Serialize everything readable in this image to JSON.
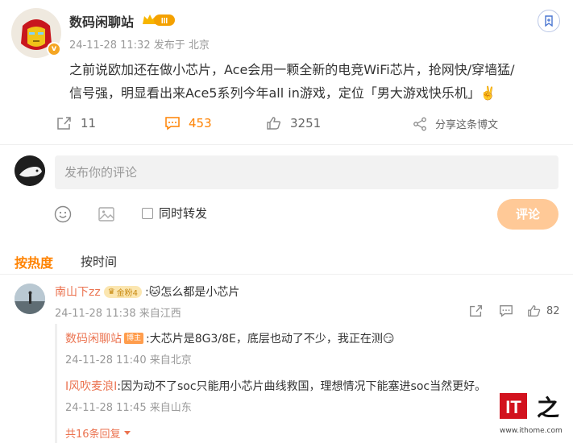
{
  "post": {
    "author": "数码闲聊站",
    "badge_level": "III",
    "verified_mark": "v",
    "meta": "24-11-28 11:32  发布于 北京",
    "content": "之前说欧加还在做小芯片，Ace会用一颗全新的电竞WiFi芯片，抢网快/穿墙猛/信号强，明显看出来Ace5系列今年all in游戏，定位「男大游戏快乐机」✌️",
    "actions": {
      "repost_count": "11",
      "comment_count": "453",
      "like_count": "3251",
      "share_label": "分享这条博文"
    }
  },
  "compose": {
    "placeholder": "发布你的评论",
    "forward_label": "同时转发",
    "submit_label": "评论"
  },
  "sort": {
    "hot_label": "按热度",
    "time_label": "按时间"
  },
  "comment": {
    "user": "南山下zz",
    "badge": "金粉4",
    "text": ":🐱怎么都是小芯片",
    "meta": "24-11-28 11:38 来自江西",
    "like_count": "82"
  },
  "replies": [
    {
      "user": "数码闲聊站",
      "badge": "博主",
      "text": ":大芯片是8G3/8E，底层也动了不少，我正在测😏",
      "meta": "24-11-28 11:40 来自北京"
    },
    {
      "user": "I风吹麦浪I",
      "text": ":因为动不了soc只能用小芯片曲线救国，理想情况下能塞进soc当然更好。",
      "meta": "24-11-28 11:45 来自山东"
    }
  ],
  "more_replies": "共16条回复",
  "watermark": {
    "logo": "IT之家",
    "url": "www.ithome.com"
  },
  "colors": {
    "accent_orange": "#ff8200",
    "username_red": "#eb7350",
    "submit_disabled": "#ffc997",
    "meta_gray": "#999999"
  }
}
